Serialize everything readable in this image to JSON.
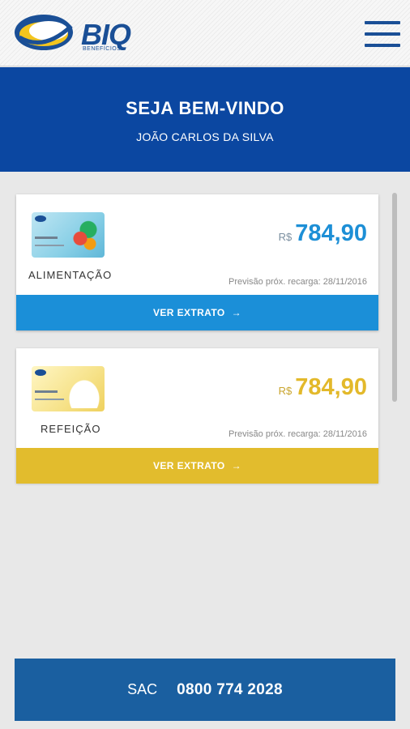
{
  "brand": {
    "name": "BIQ",
    "tagline": "BENEFÍCIOS"
  },
  "header": {
    "menu_icon": "hamburger-menu-icon"
  },
  "welcome": {
    "title": "SEJA BEM-VINDO",
    "user_name": "JOÃO CARLOS DA SILVA"
  },
  "cards": [
    {
      "label": "ALIMENTAÇÃO",
      "currency": "R$",
      "balance": "784,90",
      "forecast": "Previsão próx. recarga: 28/11/2016",
      "button_label": "VER EXTRATO",
      "accent_color": "#1b8fd8"
    },
    {
      "label": "REFEIÇÃO",
      "currency": "R$",
      "balance": "784,90",
      "forecast": "Previsão próx. recarga: 28/11/2016",
      "button_label": "VER EXTRATO",
      "accent_color": "#e2bc2d"
    }
  ],
  "sac": {
    "label": "SAC",
    "phone": "0800 774 2028"
  },
  "colors": {
    "primary": "#0b47a1",
    "sac_bg": "#1a5fa0"
  }
}
